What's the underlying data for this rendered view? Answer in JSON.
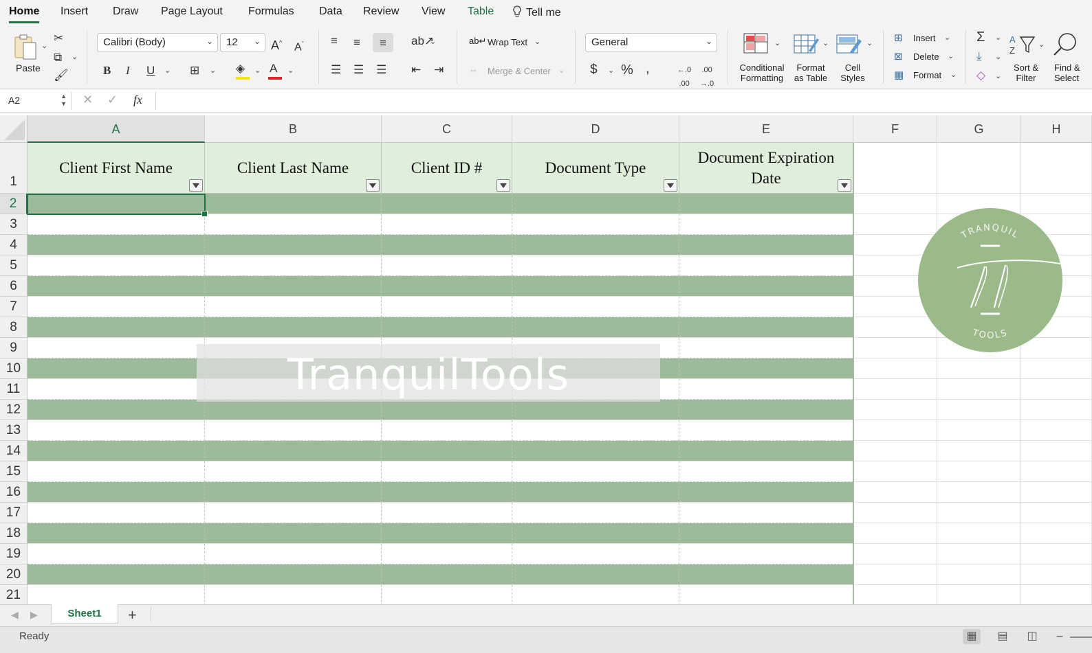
{
  "ribbon_tabs": [
    "Home",
    "Insert",
    "Draw",
    "Page Layout",
    "Formulas",
    "Data",
    "Review",
    "View",
    "Table",
    "Tell me"
  ],
  "ribbon": {
    "paste_label": "Paste",
    "font_name": "Calibri (Body)",
    "font_size": "12",
    "wrap_text_label": "Wrap Text",
    "merge_center_label": "Merge & Center",
    "number_format": "General",
    "conditional_formatting_label": [
      "Conditional",
      "Formatting"
    ],
    "format_as_table_label": [
      "Format",
      "as Table"
    ],
    "cell_styles_label": [
      "Cell",
      "Styles"
    ],
    "insert_label": "Insert",
    "delete_label": "Delete",
    "format_label": "Format",
    "sort_filter_label": [
      "Sort &",
      "Filter"
    ],
    "find_select_label": [
      "Find &",
      "Select"
    ],
    "font_color": "#e8202a",
    "highlight_color": "#f5e900"
  },
  "formula_bar": {
    "name_box": "A2",
    "fx_label": "fx",
    "formula": ""
  },
  "columns": [
    "A",
    "B",
    "C",
    "D",
    "E",
    "F",
    "G",
    "H"
  ],
  "selected_column": "A",
  "selected_row": "2",
  "rows": [
    "1",
    "2",
    "3",
    "4",
    "5",
    "6",
    "7",
    "8",
    "9",
    "10",
    "11",
    "12",
    "13",
    "14",
    "15",
    "16",
    "17",
    "18",
    "19",
    "20",
    "21"
  ],
  "table_headers": [
    "Client First Name",
    "Client Last Name",
    "Client ID #",
    "Document Type",
    "Document Expiration Date"
  ],
  "watermark": "TranquilTools",
  "logo": {
    "top_text": "TRANQUIL",
    "bottom_text": "TOOLS",
    "color": "#9cb98a"
  },
  "sheets": [
    "Sheet1"
  ],
  "status": "Ready",
  "colors": {
    "accent": "#1f7244",
    "band": "#9dba9a",
    "header_fill": "#e0eedc"
  }
}
